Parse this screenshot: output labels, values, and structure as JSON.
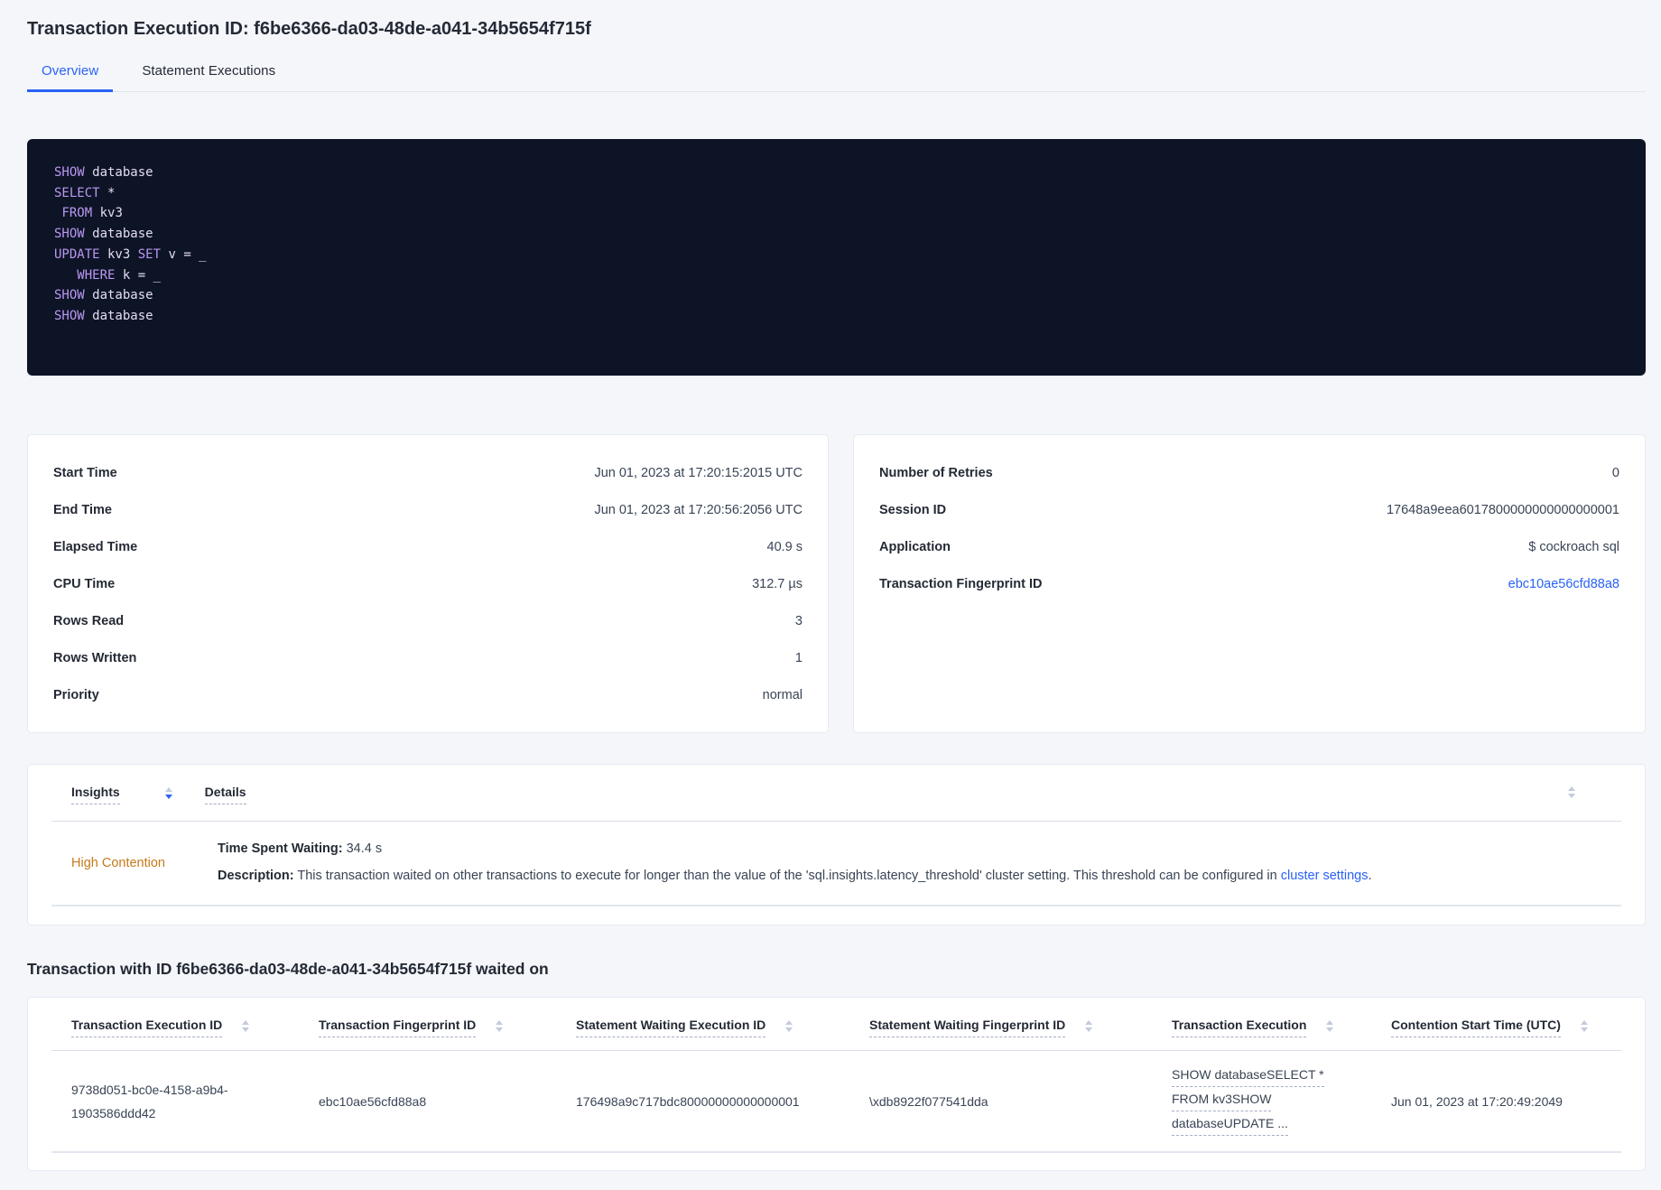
{
  "colors": {
    "accent_blue": "#2a62f5",
    "code_background": "#0d1426",
    "code_keyword_purple": "#bb97f2",
    "code_plain": "#e4ddf4",
    "high_contention_orange": "#c6791b",
    "page_background": "#f4f6fa"
  },
  "header": {
    "title": "Transaction Execution ID: f6be6366-da03-48de-a041-34b5654f715f",
    "tabs": [
      {
        "label": "Overview",
        "active": true
      },
      {
        "label": "Statement Executions",
        "active": false
      }
    ]
  },
  "sql_box": {
    "lines": [
      [
        {
          "t": "SHOW",
          "k": true
        },
        {
          "t": " database"
        }
      ],
      [
        {
          "t": "SELECT",
          "k": true
        },
        {
          "t": " *"
        }
      ],
      [
        {
          "t": " "
        },
        {
          "t": "FROM",
          "k": true
        },
        {
          "t": " kv3"
        }
      ],
      [
        {
          "t": "SHOW",
          "k": true
        },
        {
          "t": " database"
        }
      ],
      [
        {
          "t": "UPDATE",
          "k": true
        },
        {
          "t": " kv3 "
        },
        {
          "t": "SET",
          "k": true
        },
        {
          "t": " v = _"
        }
      ],
      [
        {
          "t": "   "
        },
        {
          "t": "WHERE",
          "k": true
        },
        {
          "t": " k = _"
        }
      ],
      [
        {
          "t": "SHOW",
          "k": true
        },
        {
          "t": " database"
        }
      ],
      [
        {
          "t": "SHOW",
          "k": true
        },
        {
          "t": " database"
        }
      ]
    ]
  },
  "summary_left": {
    "rows": [
      {
        "label": "Start Time",
        "value": "Jun 01, 2023 at 17:20:15:2015 UTC"
      },
      {
        "label": "End Time",
        "value": "Jun 01, 2023 at 17:20:56:2056 UTC"
      },
      {
        "label": "Elapsed Time",
        "value": "40.9 s"
      },
      {
        "label": "CPU Time",
        "value": "312.7 µs"
      },
      {
        "label": "Rows Read",
        "value": "3"
      },
      {
        "label": "Rows Written",
        "value": "1"
      },
      {
        "label": "Priority",
        "value": "normal"
      }
    ]
  },
  "summary_right": {
    "rows": [
      {
        "label": "Number of Retries",
        "value": "0"
      },
      {
        "label": "Session ID",
        "value": "17648a9eea6017800000000000000001"
      },
      {
        "label": "Application",
        "value": "$ cockroach sql"
      },
      {
        "label": "Transaction Fingerprint ID",
        "value": "ebc10ae56cfd88a8",
        "link": true
      }
    ]
  },
  "insights": {
    "columns": [
      {
        "label": "Insights",
        "sorted": true
      },
      {
        "label": "Details",
        "sorted": false
      }
    ],
    "row": {
      "insight": "High Contention",
      "time_label": "Time Spent Waiting:",
      "time_value": " 34.4 s",
      "description_label": "Description:",
      "description_text": " This transaction waited on other transactions to execute for longer than the value of the 'sql.insights.latency_threshold' cluster setting. This threshold can be configured in ",
      "description_link": "cluster settings",
      "description_after": "."
    }
  },
  "waited": {
    "heading": "Transaction with ID f6be6366-da03-48de-a041-34b5654f715f waited on",
    "columns": [
      "Transaction Execution ID",
      "Transaction Fingerprint ID",
      "Statement Waiting Execution ID",
      "Statement Waiting Fingerprint ID",
      "Transaction Execution",
      "Contention Start Time (UTC)"
    ],
    "row": {
      "transaction_execution_id": "9738d051-bc0e-4158-a9b4-1903586ddd42",
      "transaction_fingerprint_id": "ebc10ae56cfd88a8",
      "statement_waiting_execution_id": "176498a9c717bdc80000000000000001",
      "statement_waiting_fingerprint_id": "\\xdb8922f077541dda",
      "transaction_execution_lines": [
        "SHOW databaseSELECT *",
        "FROM kv3SHOW",
        "databaseUPDATE ..."
      ],
      "contention_start_time": "Jun 01, 2023 at 17:20:49:2049"
    }
  }
}
